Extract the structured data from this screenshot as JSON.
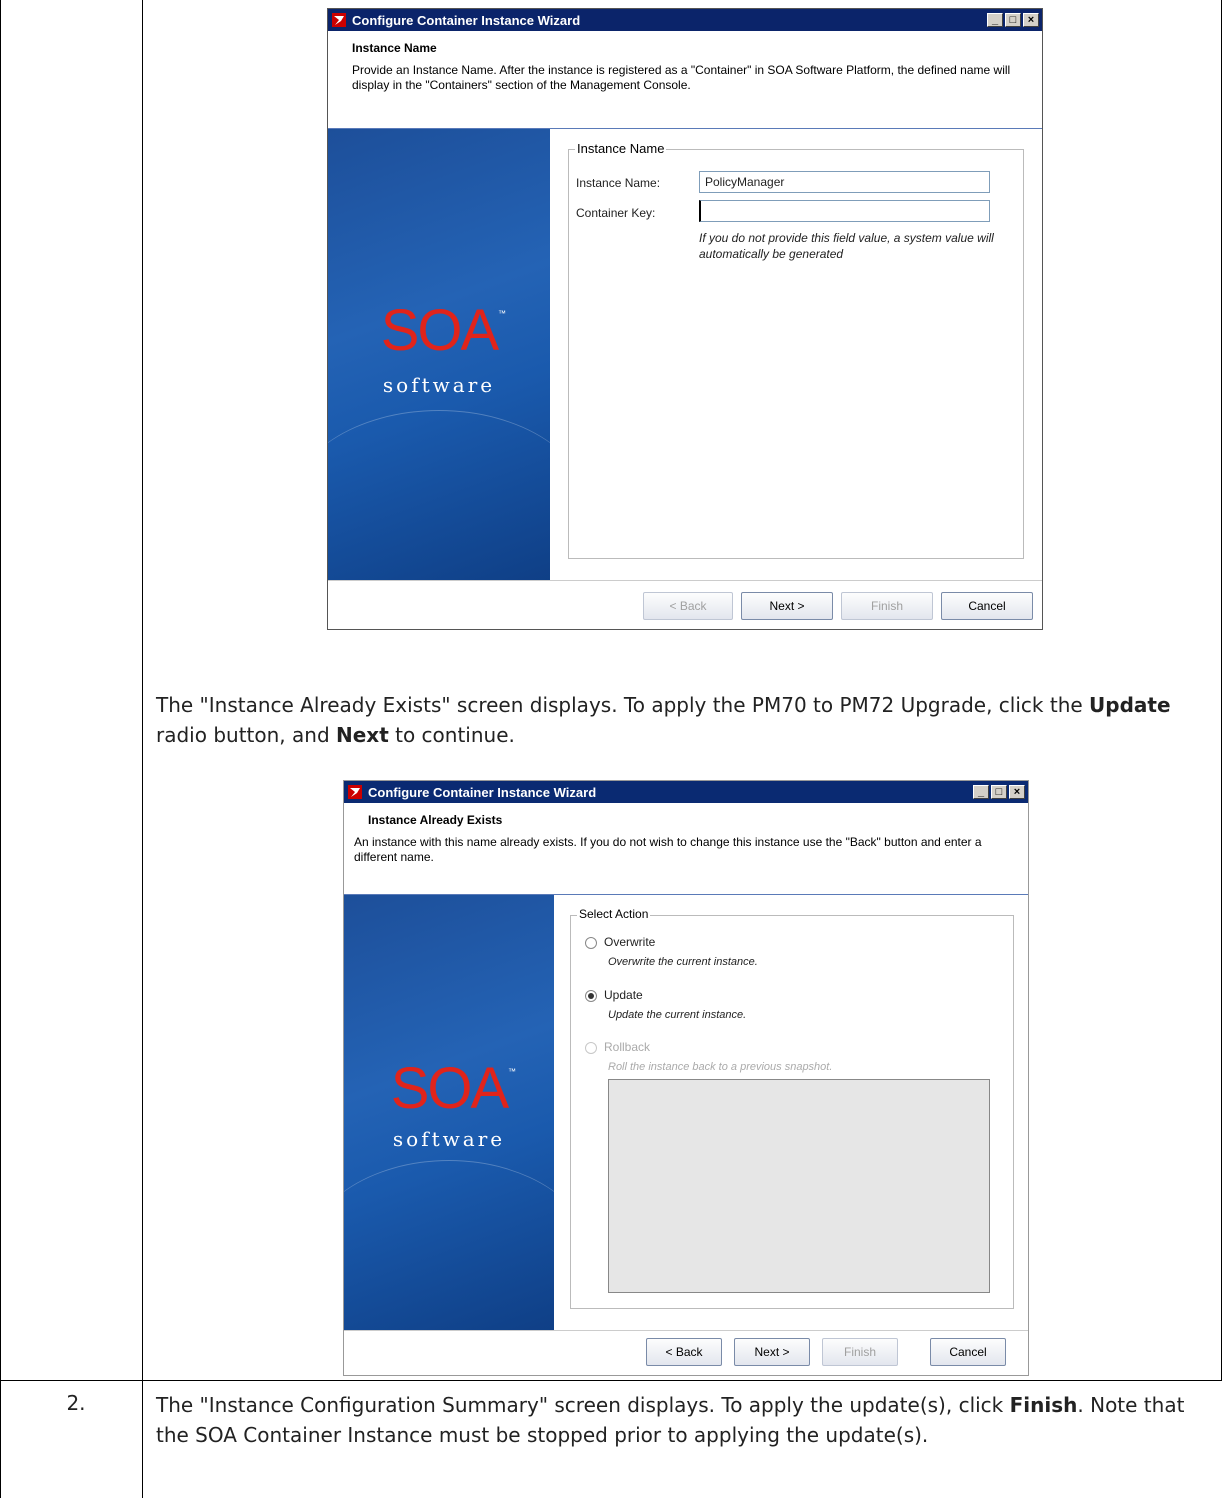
{
  "step2_number": "2.",
  "paragraph1": {
    "text_a": "The \"Instance Already Exists\" screen displays. To apply the PM70 to PM72 Upgrade, click the ",
    "bold_update": "Update",
    "text_b": " radio button, and ",
    "bold_next": "Next",
    "text_c": " to continue."
  },
  "paragraph2": {
    "text_a": "The \"Instance Configuration Summary\" screen displays. To apply the update(s), click ",
    "bold_finish": "Finish",
    "text_b": ". Note that the SOA Container Instance must be stopped prior to applying the update(s)."
  },
  "wizard1": {
    "title": "Configure Container Instance Wizard",
    "heading": "Instance Name",
    "description": "Provide an Instance Name. After the instance is registered as a \"Container\" in SOA Software Platform, the defined name will display in the \"Containers\" section of the Management Console.",
    "logo_main": "SOA",
    "logo_tm": "™",
    "logo_sub": "software",
    "group_legend": "Instance Name",
    "instance_name_label": "Instance Name:",
    "instance_name_value": "PolicyManager",
    "container_key_label": "Container Key:",
    "container_key_value": "",
    "hint": "If you do not provide this field value, a system value will automatically be generated",
    "buttons": {
      "back": "< Back",
      "next": "Next >",
      "finish": "Finish",
      "cancel": "Cancel"
    }
  },
  "wizard2": {
    "title": "Configure Container Instance Wizard",
    "heading": "Instance Already Exists",
    "description": "An instance with this name already exists.  If you do not wish to change this instance use the \"Back\" button and enter a different name.",
    "logo_main": "SOA",
    "logo_tm": "™",
    "logo_sub": "software",
    "group_legend": "Select Action",
    "options": [
      {
        "label": "Overwrite",
        "desc": "Overwrite the current instance.",
        "selected": false,
        "enabled": true
      },
      {
        "label": "Update",
        "desc": "Update the current instance.",
        "selected": true,
        "enabled": true
      },
      {
        "label": "Rollback",
        "desc": "Roll the instance back to a previous snapshot.",
        "selected": false,
        "enabled": false
      }
    ],
    "buttons": {
      "back": "< Back",
      "next": "Next >",
      "finish": "Finish",
      "cancel": "Cancel"
    }
  },
  "colors": {
    "titlebar": "#0b246a",
    "logo_red": "#e0241b",
    "sidebar_blue": "#2463b5"
  }
}
